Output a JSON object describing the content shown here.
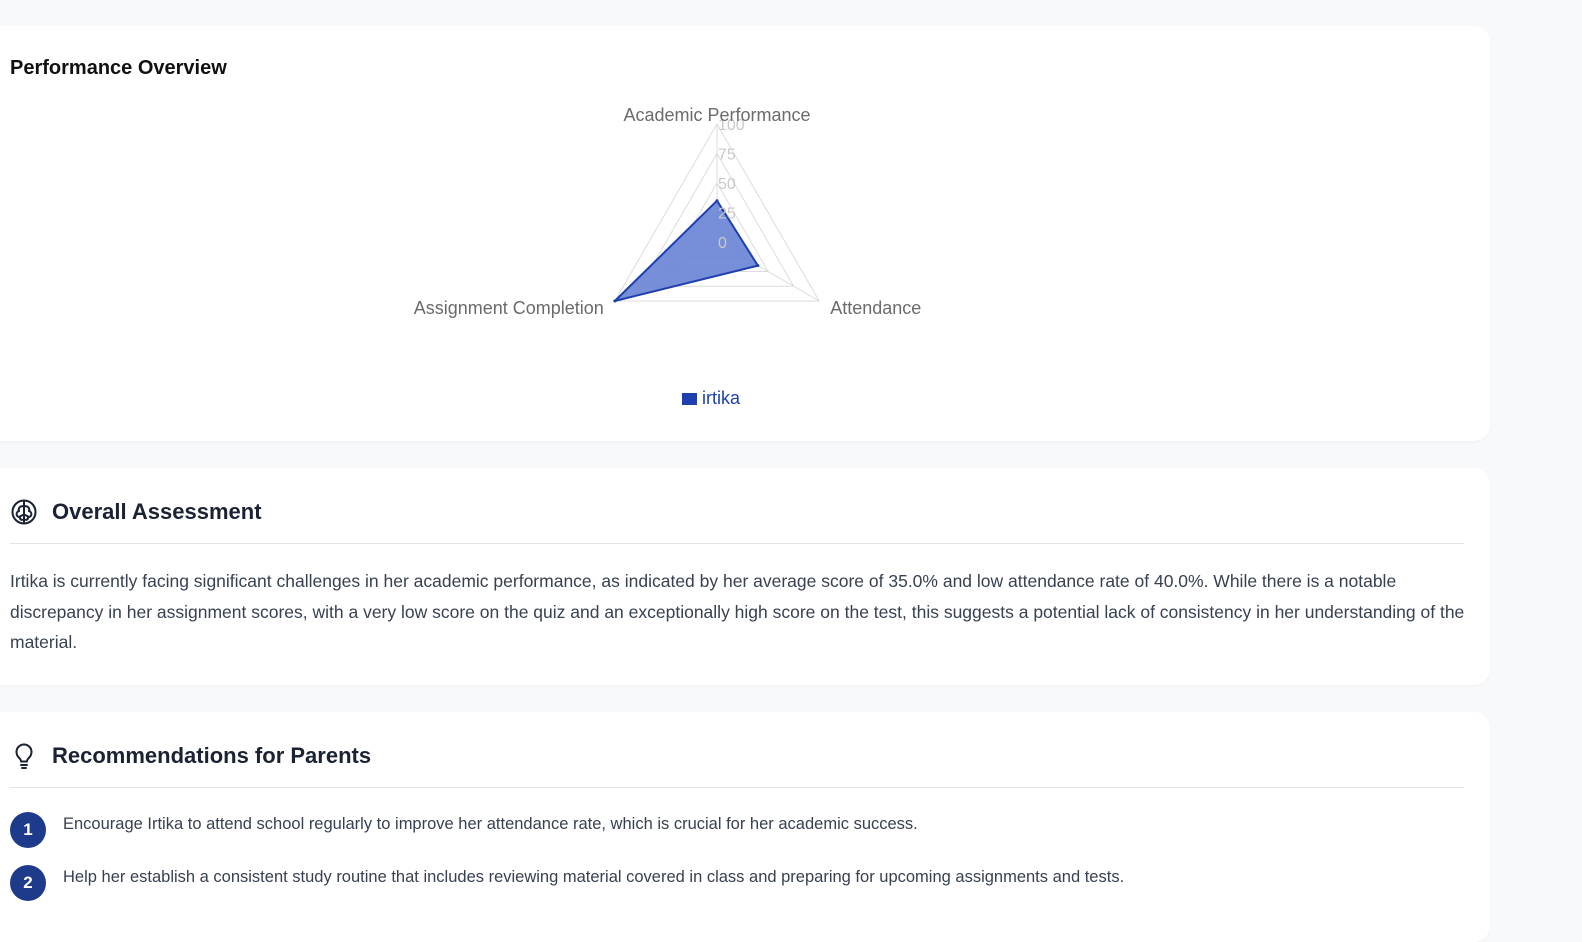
{
  "performance": {
    "title": "Performance Overview",
    "chart_data": {
      "type": "radar",
      "axes": [
        "Academic Performance",
        "Attendance",
        "Assignment Completion"
      ],
      "range": [
        0,
        100
      ],
      "ticks": [
        "0",
        "25",
        "50",
        "75",
        "100"
      ],
      "tick_values": [
        0,
        25,
        50,
        75,
        100
      ],
      "series": [
        {
          "name": "irtika",
          "values": [
            35,
            40,
            100
          ],
          "color": "#1e40af",
          "fill": "#6b84d6"
        }
      ],
      "legend_position": "bottom",
      "grid": true
    }
  },
  "assessment": {
    "title": "Overall Assessment",
    "icon": "brain-icon",
    "text": "Irtika is currently facing significant challenges in her academic performance, as indicated by her average score of 35.0% and low attendance rate of 40.0%. While there is a notable discrepancy in her assignment scores, with a very low score on the quiz and an exceptionally high score on the test, this suggests a potential lack of consistency in her understanding of the material."
  },
  "recommendations": {
    "title": "Recommendations for Parents",
    "icon": "lightbulb-icon",
    "items": [
      {
        "number": "1",
        "text": "Encourage Irtika to attend school regularly to improve her attendance rate, which is crucial for her academic success."
      },
      {
        "number": "2",
        "text": "Help her establish a consistent study routine that includes reviewing material covered in class and preparing for upcoming assignments and tests."
      }
    ]
  },
  "colors": {
    "badge": "#1e3a8a",
    "series": "#1e40af"
  }
}
